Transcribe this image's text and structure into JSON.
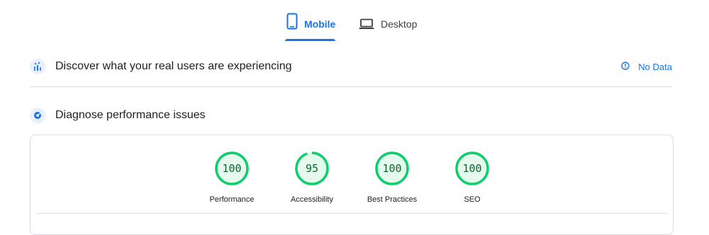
{
  "tabs": [
    {
      "label": "Mobile",
      "icon": "smartphone-icon",
      "active": true
    },
    {
      "label": "Desktop",
      "icon": "laptop-icon",
      "active": false
    }
  ],
  "field_data": {
    "title": "Discover what your real users are experiencing",
    "icon": "crux-chart-icon",
    "status_label": "No Data",
    "status_icon": "info-icon"
  },
  "lab_data": {
    "title": "Diagnose performance issues",
    "icon": "lighthouse-icon"
  },
  "scores": [
    {
      "value": "100",
      "label": "Performance",
      "score": 1.0
    },
    {
      "value": "95",
      "label": "Accessibility",
      "score": 0.95
    },
    {
      "value": "100",
      "label": "Best Practices",
      "score": 1.0
    },
    {
      "value": "100",
      "label": "SEO",
      "score": 1.0
    }
  ],
  "colors": {
    "accent": "#1a73e8",
    "pass_ring": "#0cce6b",
    "pass_fill": "#e6f9ee",
    "pass_text": "#0d652d"
  }
}
